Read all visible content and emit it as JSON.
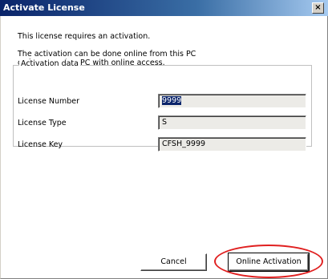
{
  "window": {
    "title": "Activate License",
    "close_glyph": "×"
  },
  "intro": {
    "line1": "This license requires an activation.",
    "line2": "The activation can be done online from this PC",
    "line3": "or from another PC with online access."
  },
  "group": {
    "legend": "Activation data",
    "license_number": {
      "label": "License Number",
      "value": "9999"
    },
    "license_type": {
      "label": "License Type",
      "value": "S"
    },
    "license_key": {
      "label": "License Key",
      "value": "CFSH_9999"
    }
  },
  "buttons": {
    "cancel": "Cancel",
    "online_activation": "Online Activation"
  },
  "colors": {
    "title_gradient_start": "#0a246a",
    "highlight_circle": "#e02020",
    "selection": "#0a246a"
  }
}
